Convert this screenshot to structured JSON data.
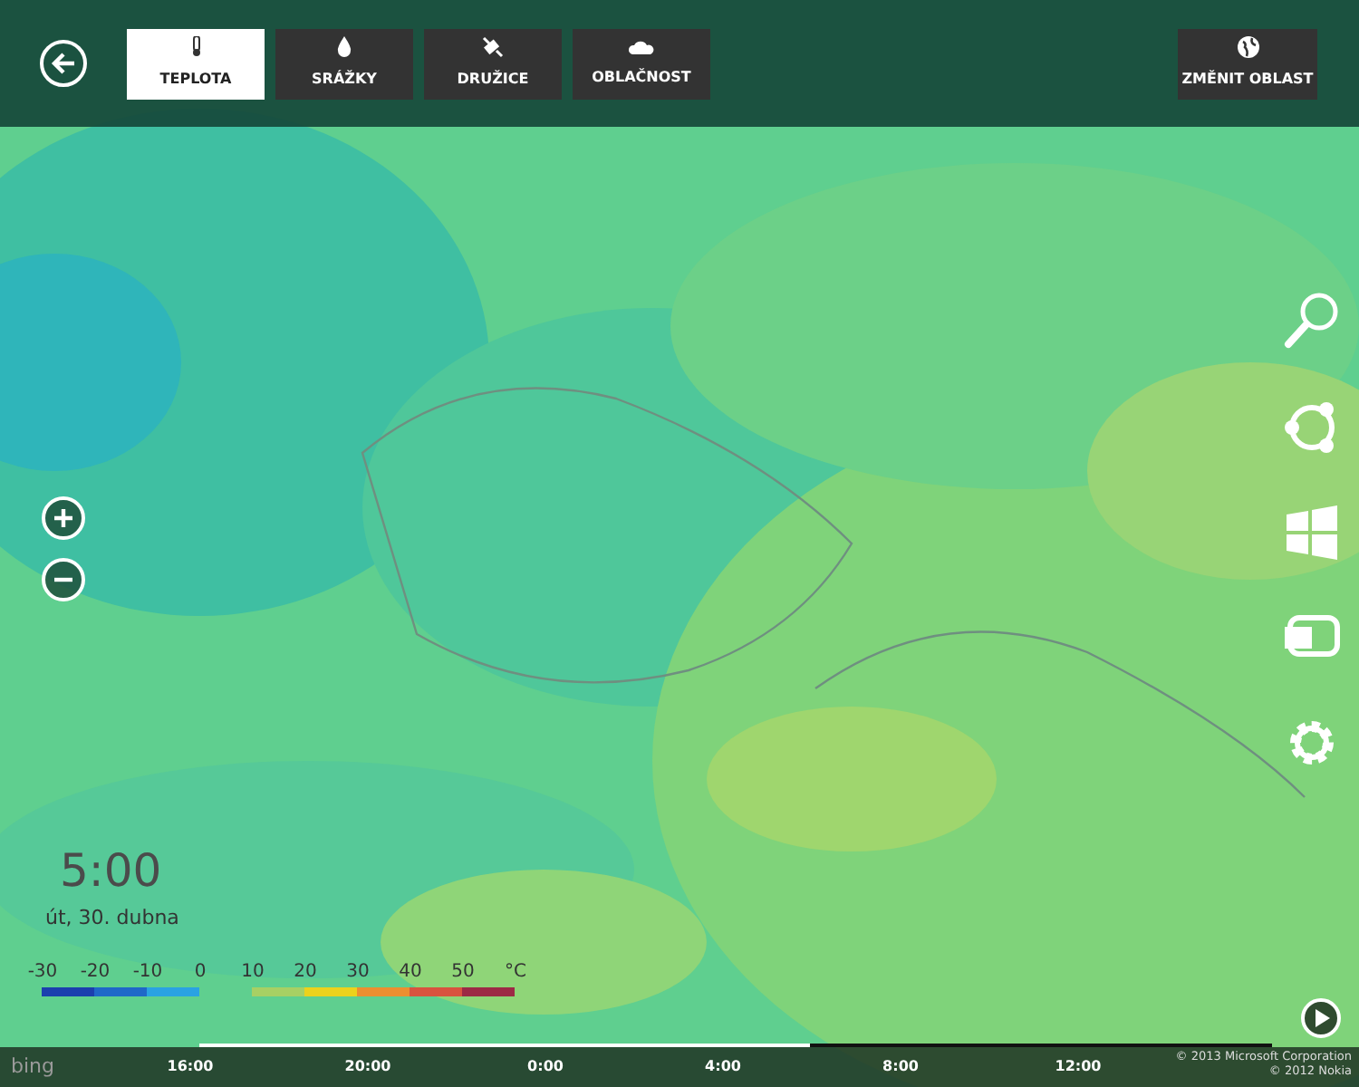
{
  "top_bar": {
    "tabs": [
      {
        "label": "TEPLOTA",
        "selected": true
      },
      {
        "label": "SRÁŽKY",
        "selected": false
      },
      {
        "label": "DRUŽICE",
        "selected": false
      },
      {
        "label": "OBLAČNOST",
        "selected": false
      }
    ],
    "change_area_button": {
      "label": "ZMĚNIT OBLAST"
    }
  },
  "time": "5:00",
  "date": "út, 30. dubna",
  "legend": {
    "labels": [
      "-30",
      "-20",
      "-10",
      "0",
      "10",
      "20",
      "30",
      "40",
      "50",
      "°C"
    ],
    "segments": [
      {
        "kind": "band",
        "color": "#1b3fae"
      },
      {
        "kind": "band",
        "color": "#1f68c8"
      },
      {
        "kind": "band",
        "color": "#2aa2e2"
      },
      {
        "kind": "gap"
      },
      {
        "kind": "band",
        "color": "#a7d064"
      },
      {
        "kind": "band",
        "color": "#ecd21c"
      },
      {
        "kind": "band",
        "color": "#ec8f30"
      },
      {
        "kind": "band",
        "color": "#d9533f"
      },
      {
        "kind": "band",
        "color": "#9c2a45"
      }
    ]
  },
  "timeline": {
    "level": 0.57,
    "times": [
      "16:00",
      "20:00",
      "0:00",
      "4:00",
      "8:00",
      "12:00"
    ]
  },
  "logo": "bing",
  "attribution": [
    "© 2013 Microsoft Corporation",
    "© 2012 Nokia"
  ]
}
